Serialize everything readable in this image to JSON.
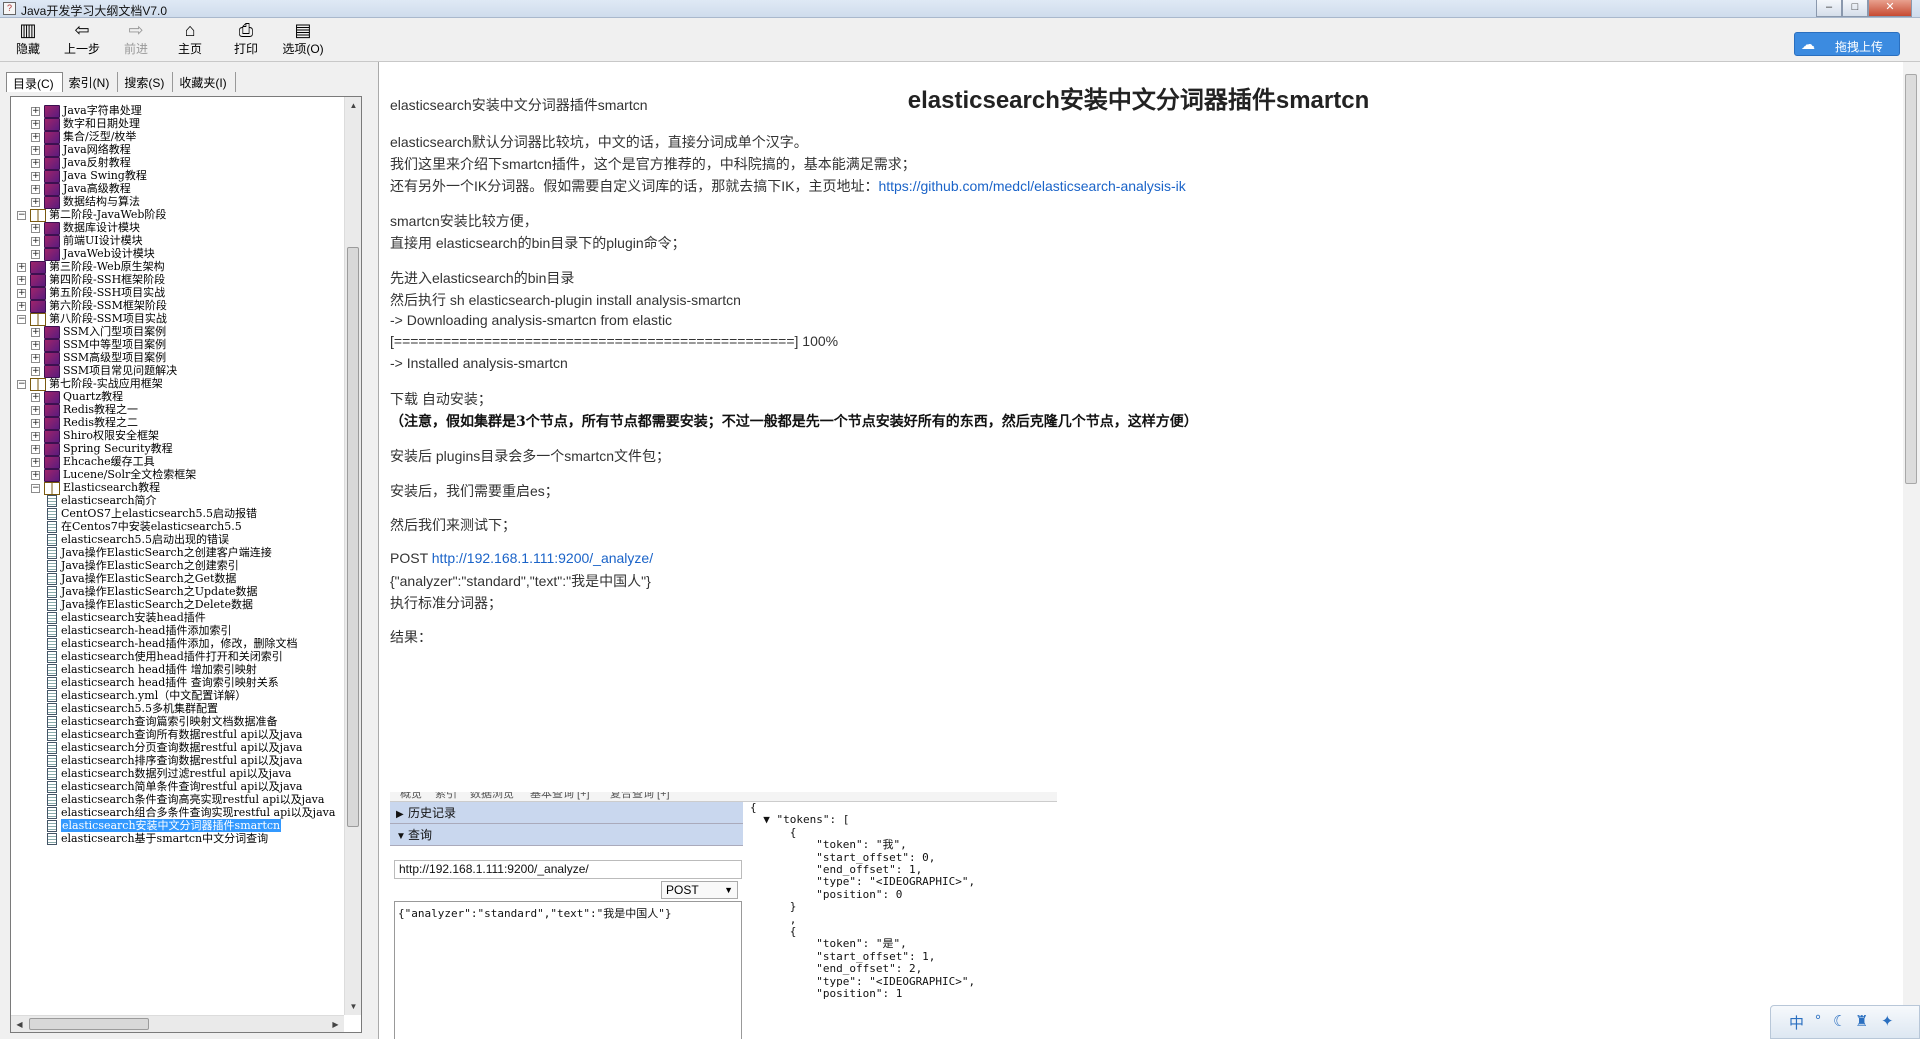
{
  "window": {
    "title": "Java开发学习大纲文档V7.0",
    "controls": [
      "minimize",
      "maximize",
      "close"
    ]
  },
  "toolbar": {
    "buttons": [
      {
        "label": "隐藏",
        "icon": "hide-icon",
        "enabled": true
      },
      {
        "label": "上一步",
        "icon": "back-arrow-icon",
        "enabled": true
      },
      {
        "label": "前进",
        "icon": "forward-arrow-icon",
        "enabled": false
      },
      {
        "label": "主页",
        "icon": "home-icon",
        "enabled": true
      },
      {
        "label": "打印",
        "icon": "printer-icon",
        "enabled": true
      },
      {
        "label": "选项(O)",
        "icon": "options-icon",
        "enabled": true
      }
    ],
    "upload_label": "拖拽上传"
  },
  "nav": {
    "tabs": [
      "目录(C)",
      "索引(N)",
      "搜索(S)",
      "收藏夹(I)"
    ],
    "active_tab": 0,
    "tree": [
      {
        "level": 1,
        "type": "book",
        "expanded": false,
        "label": "Java字符串处理"
      },
      {
        "level": 1,
        "type": "book",
        "expanded": false,
        "label": "数字和日期处理"
      },
      {
        "level": 1,
        "type": "book",
        "expanded": false,
        "label": "集合/泛型/枚举"
      },
      {
        "level": 1,
        "type": "book",
        "expanded": false,
        "label": "Java网络教程"
      },
      {
        "level": 1,
        "type": "book",
        "expanded": false,
        "label": "Java反射教程"
      },
      {
        "level": 1,
        "type": "book",
        "expanded": false,
        "label": "Java Swing教程"
      },
      {
        "level": 1,
        "type": "book",
        "expanded": false,
        "label": "Java高级教程"
      },
      {
        "level": 1,
        "type": "book",
        "expanded": false,
        "label": "数据结构与算法"
      },
      {
        "level": 0,
        "type": "book",
        "expanded": true,
        "label": "第二阶段-JavaWeb阶段"
      },
      {
        "level": 1,
        "type": "book",
        "expanded": false,
        "label": "数据库设计模块"
      },
      {
        "level": 1,
        "type": "book",
        "expanded": false,
        "label": "前端UI设计模块"
      },
      {
        "level": 1,
        "type": "book",
        "expanded": false,
        "label": "JavaWeb设计模块"
      },
      {
        "level": 0,
        "type": "book",
        "expanded": false,
        "label": "第三阶段-Web原生架构"
      },
      {
        "level": 0,
        "type": "book",
        "expanded": false,
        "label": "第四阶段-SSH框架阶段"
      },
      {
        "level": 0,
        "type": "book",
        "expanded": false,
        "label": "第五阶段-SSH项目实战"
      },
      {
        "level": 0,
        "type": "book",
        "expanded": false,
        "label": "第六阶段-SSM框架阶段"
      },
      {
        "level": 0,
        "type": "book",
        "expanded": true,
        "label": "第八阶段-SSM项目实战"
      },
      {
        "level": 1,
        "type": "book",
        "expanded": false,
        "label": "SSM入门型项目案例"
      },
      {
        "level": 1,
        "type": "book",
        "expanded": false,
        "label": "SSM中等型项目案例"
      },
      {
        "level": 1,
        "type": "book",
        "expanded": false,
        "label": "SSM高级型项目案例"
      },
      {
        "level": 1,
        "type": "book",
        "expanded": false,
        "label": "SSM项目常见问题解决"
      },
      {
        "level": 0,
        "type": "book",
        "expanded": true,
        "label": "第七阶段-实战应用框架"
      },
      {
        "level": 1,
        "type": "book",
        "expanded": false,
        "label": "Quartz教程"
      },
      {
        "level": 1,
        "type": "book",
        "expanded": false,
        "label": "Redis教程之一"
      },
      {
        "level": 1,
        "type": "book",
        "expanded": false,
        "label": "Redis教程之二"
      },
      {
        "level": 1,
        "type": "book",
        "expanded": false,
        "label": "Shiro权限安全框架"
      },
      {
        "level": 1,
        "type": "book",
        "expanded": false,
        "label": "Spring Security教程"
      },
      {
        "level": 1,
        "type": "book",
        "expanded": false,
        "label": "Ehcache缓存工具"
      },
      {
        "level": 1,
        "type": "book",
        "expanded": false,
        "label": "Lucene/Solr全文检索框架"
      },
      {
        "level": 1,
        "type": "book",
        "expanded": true,
        "label": "Elasticsearch教程"
      },
      {
        "level": 2,
        "type": "page",
        "label": "elasticsearch简介"
      },
      {
        "level": 2,
        "type": "page",
        "label": "CentOS7上elasticsearch5.5启动报错"
      },
      {
        "level": 2,
        "type": "page",
        "label": "在Centos7中安装elasticsearch5.5"
      },
      {
        "level": 2,
        "type": "page",
        "label": "elasticsearch5.5启动出现的错误"
      },
      {
        "level": 2,
        "type": "page",
        "label": "Java操作ElasticSearch之创建客户端连接"
      },
      {
        "level": 2,
        "type": "page",
        "label": "Java操作ElasticSearch之创建索引"
      },
      {
        "level": 2,
        "type": "page",
        "label": "Java操作ElasticSearch之Get数据"
      },
      {
        "level": 2,
        "type": "page",
        "label": "Java操作ElasticSearch之Update数据"
      },
      {
        "level": 2,
        "type": "page",
        "label": "Java操作ElasticSearch之Delete数据"
      },
      {
        "level": 2,
        "type": "page",
        "label": "elasticsearch安装head插件"
      },
      {
        "level": 2,
        "type": "page",
        "label": "elasticsearch-head插件添加索引"
      },
      {
        "level": 2,
        "type": "page",
        "label": "elasticsearch-head插件添加，修改，删除文档"
      },
      {
        "level": 2,
        "type": "page",
        "label": "elasticsearch使用head插件打开和关闭索引"
      },
      {
        "level": 2,
        "type": "page",
        "label": "elasticsearch head插件 增加索引映射"
      },
      {
        "level": 2,
        "type": "page",
        "label": "elasticsearch head插件 查询索引映射关系"
      },
      {
        "level": 2,
        "type": "page",
        "label": "elasticsearch.yml（中文配置详解）"
      },
      {
        "level": 2,
        "type": "page",
        "label": "elasticsearch5.5多机集群配置"
      },
      {
        "level": 2,
        "type": "page",
        "label": "elasticsearch查询篇索引映射文档数据准备"
      },
      {
        "level": 2,
        "type": "page",
        "label": "elasticsearch查询所有数据restful api以及java"
      },
      {
        "level": 2,
        "type": "page",
        "label": "elasticsearch分页查询数据restful api以及java"
      },
      {
        "level": 2,
        "type": "page",
        "label": "elasticsearch排序查询数据restful api以及java"
      },
      {
        "level": 2,
        "type": "page",
        "label": "elasticsearch数据列过滤restful api以及java"
      },
      {
        "level": 2,
        "type": "page",
        "label": "elasticsearch简单条件查询restful api以及java"
      },
      {
        "level": 2,
        "type": "page",
        "label": "elasticsearch条件查询高亮实现restful api以及java"
      },
      {
        "level": 2,
        "type": "page",
        "label": "elasticsearch组合多条件查询实现restful api以及java"
      },
      {
        "level": 2,
        "type": "page",
        "label": "elasticsearch安装中文分词器插件smartcn",
        "selected": true
      },
      {
        "level": 2,
        "type": "page",
        "label": "elasticsearch基于smartcn中文分词查询"
      }
    ]
  },
  "article": {
    "title": "elasticsearch安装中文分词器插件smartcn",
    "lines": [
      {
        "text": "elasticsearch安装中文分词器插件smartcn"
      },
      {
        "text": "elasticsearch默认分词器比较坑，中文的话，直接分词成单个汉字。"
      },
      {
        "text": "我们这里来介绍下smartcn插件，这个是官方推荐的，中科院搞的，基本能满足需求；"
      },
      {
        "text": "还有另外一个IK分词器。假如需要自定义词库的话，那就去搞下IK，主页地址：",
        "link": "https://github.com/medcl/elasticsearch-analysis-ik"
      },
      {
        "text": "smartcn安装比较方便，"
      },
      {
        "text": "直接用  elasticsearch的bin目录下的plugin命令；"
      },
      {
        "text": "先进入elasticsearch的bin目录"
      },
      {
        "text": "然后执行 sh elasticsearch-plugin install analysis-smartcn"
      },
      {
        "text": "-> Downloading analysis-smartcn from elastic"
      },
      {
        "text": "[=================================================] 100%"
      },
      {
        "text": "-> Installed analysis-smartcn"
      },
      {
        "text": "下载  自动安装；"
      },
      {
        "text": "（注意，假如集群是3个节点，所有节点都需要安装；不过一般都是先一个节点安装好所有的东西，然后克隆几个节点，这样方便）",
        "bold": true
      },
      {
        "text": "安装后 plugins目录会多一个smartcn文件包；"
      },
      {
        "text": "安装后，我们需要重启es；"
      },
      {
        "text": "然后我们来测试下；"
      },
      {
        "text": "POST ",
        "link": "http://192.168.1.111:9200/_analyze/"
      },
      {
        "text": "{\"analyzer\":\"standard\",\"text\":\"我是中国人\"}"
      },
      {
        "text": "执行标准分词器；"
      },
      {
        "text": "结果："
      }
    ]
  },
  "screenshot": {
    "tabs_partial": [
      "概览",
      "索引",
      "数据浏览",
      "基本查询 [+]",
      "复合查询 [+]"
    ],
    "history_label": "历史记录",
    "query_label": "查询",
    "url": "http://192.168.1.111:9200/_analyze/",
    "method": "POST",
    "body": "{\"analyzer\":\"standard\",\"text\":\"我是中国人\"}",
    "json_lines": [
      "{",
      "  ▼ \"tokens\": [",
      "      {",
      "          \"token\": \"我\",",
      "          \"start_offset\": 0,",
      "          \"end_offset\": 1,",
      "          \"type\": \"<IDEOGRAPHIC>\",",
      "          \"position\": 0",
      "      }",
      "      ,",
      "      {",
      "          \"token\": \"是\",",
      "          \"start_offset\": 1,",
      "          \"end_offset\": 2,",
      "          \"type\": \"<IDEOGRAPHIC>\",",
      "          \"position\": 1"
    ]
  },
  "ime": {
    "text": "中"
  },
  "colors": {
    "accent": "#3399ff",
    "link": "#1a63c8",
    "upload": "#3c8be0"
  }
}
